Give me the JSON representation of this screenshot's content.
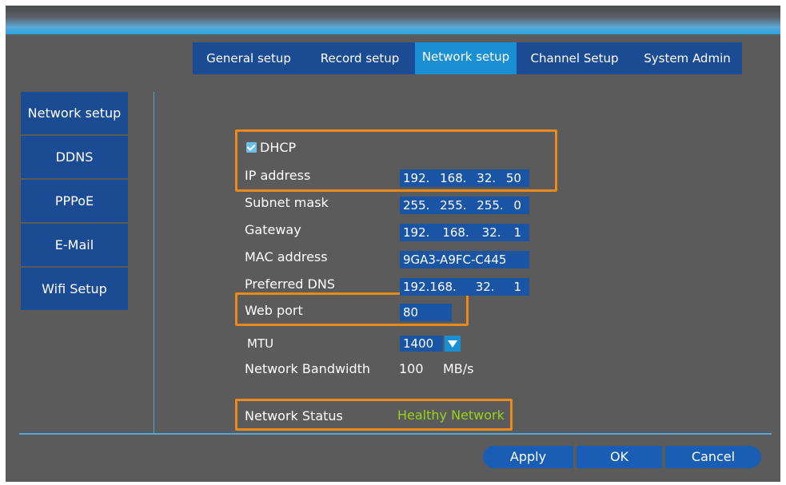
{
  "tabs": [
    {
      "label": "General setup"
    },
    {
      "label": "Record setup"
    },
    {
      "label": "Network setup"
    },
    {
      "label": "Channel Setup"
    },
    {
      "label": "System Admin"
    }
  ],
  "active_tab": "Network setup",
  "sidebar": {
    "items": [
      {
        "label": "Network setup"
      },
      {
        "label": "DDNS"
      },
      {
        "label": "PPPoE"
      },
      {
        "label": "E-Mail"
      },
      {
        "label": "Wifi Setup"
      }
    ]
  },
  "form": {
    "dhcp": {
      "label": "DHCP",
      "checked": true
    },
    "ip_address": {
      "label": "IP address",
      "octets": [
        "192.",
        "168.",
        "32.",
        "50"
      ]
    },
    "subnet_mask": {
      "label": "Subnet mask",
      "octets": [
        "255.",
        "255.",
        "255.",
        "0"
      ]
    },
    "gateway": {
      "label": "Gateway",
      "octets": [
        "192.",
        "168.",
        "32.",
        "1"
      ]
    },
    "mac_address": {
      "label": "MAC address",
      "value": "9GA3-A9FC-C445"
    },
    "preferred_dns": {
      "label": "Preferred DNS",
      "octets": [
        "192.168.",
        "32.",
        "1"
      ]
    },
    "web_port": {
      "label": "Web port",
      "value": "80"
    },
    "mtu": {
      "label": "MTU",
      "value": "1400"
    },
    "bandwidth": {
      "label": "Network Bandwidth",
      "value": "100",
      "unit": "MB/s"
    },
    "network_status": {
      "label": "Network Status",
      "value": "Healthy Network"
    }
  },
  "buttons": {
    "apply": "Apply",
    "ok": "OK",
    "cancel": "Cancel"
  },
  "colors": {
    "background": "#5b5b5b",
    "tab": "#1b4c93",
    "tab_active": "#1a8fd3",
    "field": "#1a54a5",
    "highlight": "#ee8a19",
    "status_ok": "#9ad219"
  }
}
